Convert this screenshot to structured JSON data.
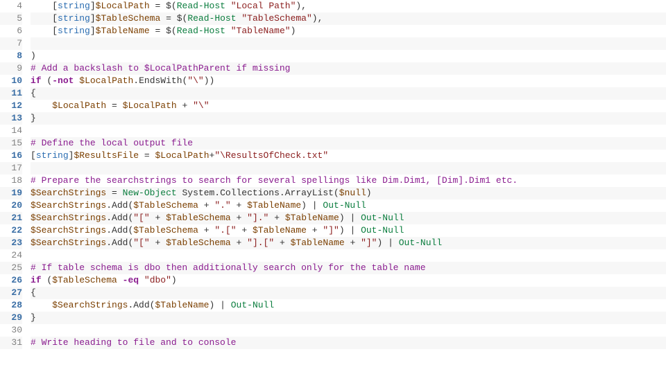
{
  "chart_data": null,
  "first_line": 4,
  "highlight_gutter": [
    8,
    10,
    11,
    12,
    13,
    16,
    19,
    20,
    21,
    22,
    23,
    26,
    27,
    28,
    29
  ],
  "lines": [
    [
      [
        "    "
      ],
      [
        "c-punc",
        "["
      ],
      [
        "c-type",
        "string"
      ],
      [
        "c-punc",
        "]"
      ],
      [
        "c-var",
        "$LocalPath"
      ],
      [
        " "
      ],
      [
        "c-op",
        "="
      ],
      [
        " "
      ],
      [
        "c-punc",
        "$("
      ],
      [
        "c-cmd",
        "Read-Host"
      ],
      [
        " "
      ],
      [
        "c-str",
        "\"Local Path\""
      ],
      [
        "c-punc",
        "),"
      ]
    ],
    [
      [
        "    "
      ],
      [
        "c-punc",
        "["
      ],
      [
        "c-type",
        "string"
      ],
      [
        "c-punc",
        "]"
      ],
      [
        "c-var",
        "$TableSchema"
      ],
      [
        " "
      ],
      [
        "c-op",
        "="
      ],
      [
        " "
      ],
      [
        "c-punc",
        "$("
      ],
      [
        "c-cmd",
        "Read-Host"
      ],
      [
        " "
      ],
      [
        "c-str",
        "\"TableSchema\""
      ],
      [
        "c-punc",
        "),"
      ]
    ],
    [
      [
        "    "
      ],
      [
        "c-punc",
        "["
      ],
      [
        "c-type",
        "string"
      ],
      [
        "c-punc",
        "]"
      ],
      [
        "c-var",
        "$TableName"
      ],
      [
        " "
      ],
      [
        "c-op",
        "="
      ],
      [
        " "
      ],
      [
        "c-punc",
        "$("
      ],
      [
        "c-cmd",
        "Read-Host"
      ],
      [
        " "
      ],
      [
        "c-str",
        "\"TableName\""
      ],
      [
        "c-punc",
        ")"
      ]
    ],
    [
      [
        ""
      ]
    ],
    [
      [
        "c-punc",
        ")"
      ]
    ],
    [
      [
        "c-cmt",
        "# Add a backslash to $LocalPathParent if missing"
      ]
    ],
    [
      [
        "c-kw",
        "if"
      ],
      [
        " "
      ],
      [
        "c-punc",
        "("
      ],
      [
        "c-kw",
        "-not"
      ],
      [
        " "
      ],
      [
        "c-var",
        "$LocalPath"
      ],
      [
        "c-dot",
        "."
      ],
      [
        "c-mem",
        "EndsWith"
      ],
      [
        "c-punc",
        "("
      ],
      [
        "c-str",
        "\"\\\""
      ],
      [
        "c-punc",
        "))"
      ]
    ],
    [
      [
        "c-punc",
        "{"
      ]
    ],
    [
      [
        "    "
      ],
      [
        "c-var",
        "$LocalPath"
      ],
      [
        " "
      ],
      [
        "c-op",
        "="
      ],
      [
        " "
      ],
      [
        "c-var",
        "$LocalPath"
      ],
      [
        " "
      ],
      [
        "c-op",
        "+"
      ],
      [
        " "
      ],
      [
        "c-str",
        "\"\\\""
      ]
    ],
    [
      [
        "c-punc",
        "}"
      ]
    ],
    [
      [
        ""
      ]
    ],
    [
      [
        "c-cmt",
        "# Define the local output file"
      ]
    ],
    [
      [
        "c-punc",
        "["
      ],
      [
        "c-type",
        "string"
      ],
      [
        "c-punc",
        "]"
      ],
      [
        "c-var",
        "$ResultsFile"
      ],
      [
        " "
      ],
      [
        "c-op",
        "="
      ],
      [
        " "
      ],
      [
        "c-var",
        "$LocalPath"
      ],
      [
        "c-op",
        "+"
      ],
      [
        "c-str",
        "\"\\ResultsOfCheck.txt\""
      ]
    ],
    [
      [
        ""
      ]
    ],
    [
      [
        "c-cmt",
        "# Prepare the searchstrings to search for several spellings like Dim.Dim1, [Dim].Dim1 etc."
      ]
    ],
    [
      [
        "c-var",
        "$SearchStrings"
      ],
      [
        " "
      ],
      [
        "c-op",
        "="
      ],
      [
        " "
      ],
      [
        "c-cmd",
        "New-Object"
      ],
      [
        " "
      ],
      [
        "c-mem",
        "System.Collections.ArrayList"
      ],
      [
        "c-punc",
        "("
      ],
      [
        "c-var",
        "$null"
      ],
      [
        "c-punc",
        ")"
      ]
    ],
    [
      [
        "c-var",
        "$SearchStrings"
      ],
      [
        "c-dot",
        "."
      ],
      [
        "c-mem",
        "Add"
      ],
      [
        "c-punc",
        "("
      ],
      [
        "c-var",
        "$TableSchema"
      ],
      [
        " "
      ],
      [
        "c-op",
        "+"
      ],
      [
        " "
      ],
      [
        "c-str",
        "\".\""
      ],
      [
        " "
      ],
      [
        "c-op",
        "+"
      ],
      [
        " "
      ],
      [
        "c-var",
        "$TableName"
      ],
      [
        "c-punc",
        ")"
      ],
      [
        " "
      ],
      [
        "c-op",
        "|"
      ],
      [
        " "
      ],
      [
        "c-cmd",
        "Out-Null"
      ]
    ],
    [
      [
        "c-var",
        "$SearchStrings"
      ],
      [
        "c-dot",
        "."
      ],
      [
        "c-mem",
        "Add"
      ],
      [
        "c-punc",
        "("
      ],
      [
        "c-str",
        "\"[\""
      ],
      [
        " "
      ],
      [
        "c-op",
        "+"
      ],
      [
        " "
      ],
      [
        "c-var",
        "$TableSchema"
      ],
      [
        " "
      ],
      [
        "c-op",
        "+"
      ],
      [
        " "
      ],
      [
        "c-str",
        "\"].\""
      ],
      [
        " "
      ],
      [
        "c-op",
        "+"
      ],
      [
        " "
      ],
      [
        "c-var",
        "$TableName"
      ],
      [
        "c-punc",
        ")"
      ],
      [
        " "
      ],
      [
        "c-op",
        "|"
      ],
      [
        " "
      ],
      [
        "c-cmd",
        "Out-Null"
      ]
    ],
    [
      [
        "c-var",
        "$SearchStrings"
      ],
      [
        "c-dot",
        "."
      ],
      [
        "c-mem",
        "Add"
      ],
      [
        "c-punc",
        "("
      ],
      [
        "c-var",
        "$TableSchema"
      ],
      [
        " "
      ],
      [
        "c-op",
        "+"
      ],
      [
        " "
      ],
      [
        "c-str",
        "\".[\""
      ],
      [
        " "
      ],
      [
        "c-op",
        "+"
      ],
      [
        " "
      ],
      [
        "c-var",
        "$TableName"
      ],
      [
        " "
      ],
      [
        "c-op",
        "+"
      ],
      [
        " "
      ],
      [
        "c-str",
        "\"]\""
      ],
      [
        "c-punc",
        ")"
      ],
      [
        " "
      ],
      [
        "c-op",
        "|"
      ],
      [
        " "
      ],
      [
        "c-cmd",
        "Out-Null"
      ]
    ],
    [
      [
        "c-var",
        "$SearchStrings"
      ],
      [
        "c-dot",
        "."
      ],
      [
        "c-mem",
        "Add"
      ],
      [
        "c-punc",
        "("
      ],
      [
        "c-str",
        "\"[\""
      ],
      [
        " "
      ],
      [
        "c-op",
        "+"
      ],
      [
        " "
      ],
      [
        "c-var",
        "$TableSchema"
      ],
      [
        " "
      ],
      [
        "c-op",
        "+"
      ],
      [
        " "
      ],
      [
        "c-str",
        "\"].[\""
      ],
      [
        " "
      ],
      [
        "c-op",
        "+"
      ],
      [
        " "
      ],
      [
        "c-var",
        "$TableName"
      ],
      [
        " "
      ],
      [
        "c-op",
        "+"
      ],
      [
        " "
      ],
      [
        "c-str",
        "\"]\""
      ],
      [
        "c-punc",
        ")"
      ],
      [
        " "
      ],
      [
        "c-op",
        "|"
      ],
      [
        " "
      ],
      [
        "c-cmd",
        "Out-Null"
      ]
    ],
    [
      [
        ""
      ]
    ],
    [
      [
        "c-cmt",
        "# If table schema is dbo then additionally search only for the table name"
      ]
    ],
    [
      [
        "c-kw",
        "if"
      ],
      [
        " "
      ],
      [
        "c-punc",
        "("
      ],
      [
        "c-var",
        "$TableSchema"
      ],
      [
        " "
      ],
      [
        "c-kw",
        "-eq"
      ],
      [
        " "
      ],
      [
        "c-str",
        "\"dbo\""
      ],
      [
        "c-punc",
        ")"
      ]
    ],
    [
      [
        "c-punc",
        "{"
      ]
    ],
    [
      [
        "    "
      ],
      [
        "c-var",
        "$SearchStrings"
      ],
      [
        "c-dot",
        "."
      ],
      [
        "c-mem",
        "Add"
      ],
      [
        "c-punc",
        "("
      ],
      [
        "c-var",
        "$TableName"
      ],
      [
        "c-punc",
        ")"
      ],
      [
        " "
      ],
      [
        "c-op",
        "|"
      ],
      [
        " "
      ],
      [
        "c-cmd",
        "Out-Null"
      ]
    ],
    [
      [
        "c-punc",
        "}"
      ]
    ],
    [
      [
        ""
      ]
    ],
    [
      [
        "c-cmt",
        "# Write heading to file and to console"
      ]
    ]
  ]
}
